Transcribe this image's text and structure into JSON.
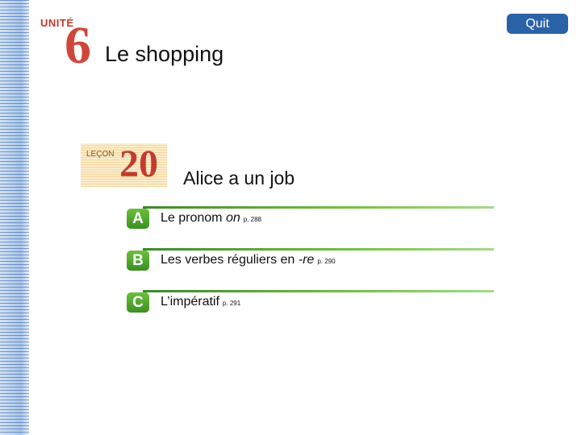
{
  "header": {
    "unite_label": "UNITÉ",
    "unit_number": "6",
    "unit_title": "Le shopping",
    "quit_label": "Quit"
  },
  "lesson": {
    "lecon_label": "LEÇON",
    "lecon_number": "20",
    "title": "Alice a un job"
  },
  "sections": [
    {
      "letter": "A",
      "text": "Le pronom ",
      "italic": "on",
      "page": "p. 288"
    },
    {
      "letter": "B",
      "text": "Les verbes réguliers en ",
      "italic": "-re",
      "page": "p. 290"
    },
    {
      "letter": "C",
      "text": "L’impératif",
      "italic": "",
      "page": "p. 291"
    }
  ],
  "colors": {
    "accent_red": "#d0473a",
    "quit_blue": "#2a62a8",
    "section_green": "#4fa42c"
  }
}
